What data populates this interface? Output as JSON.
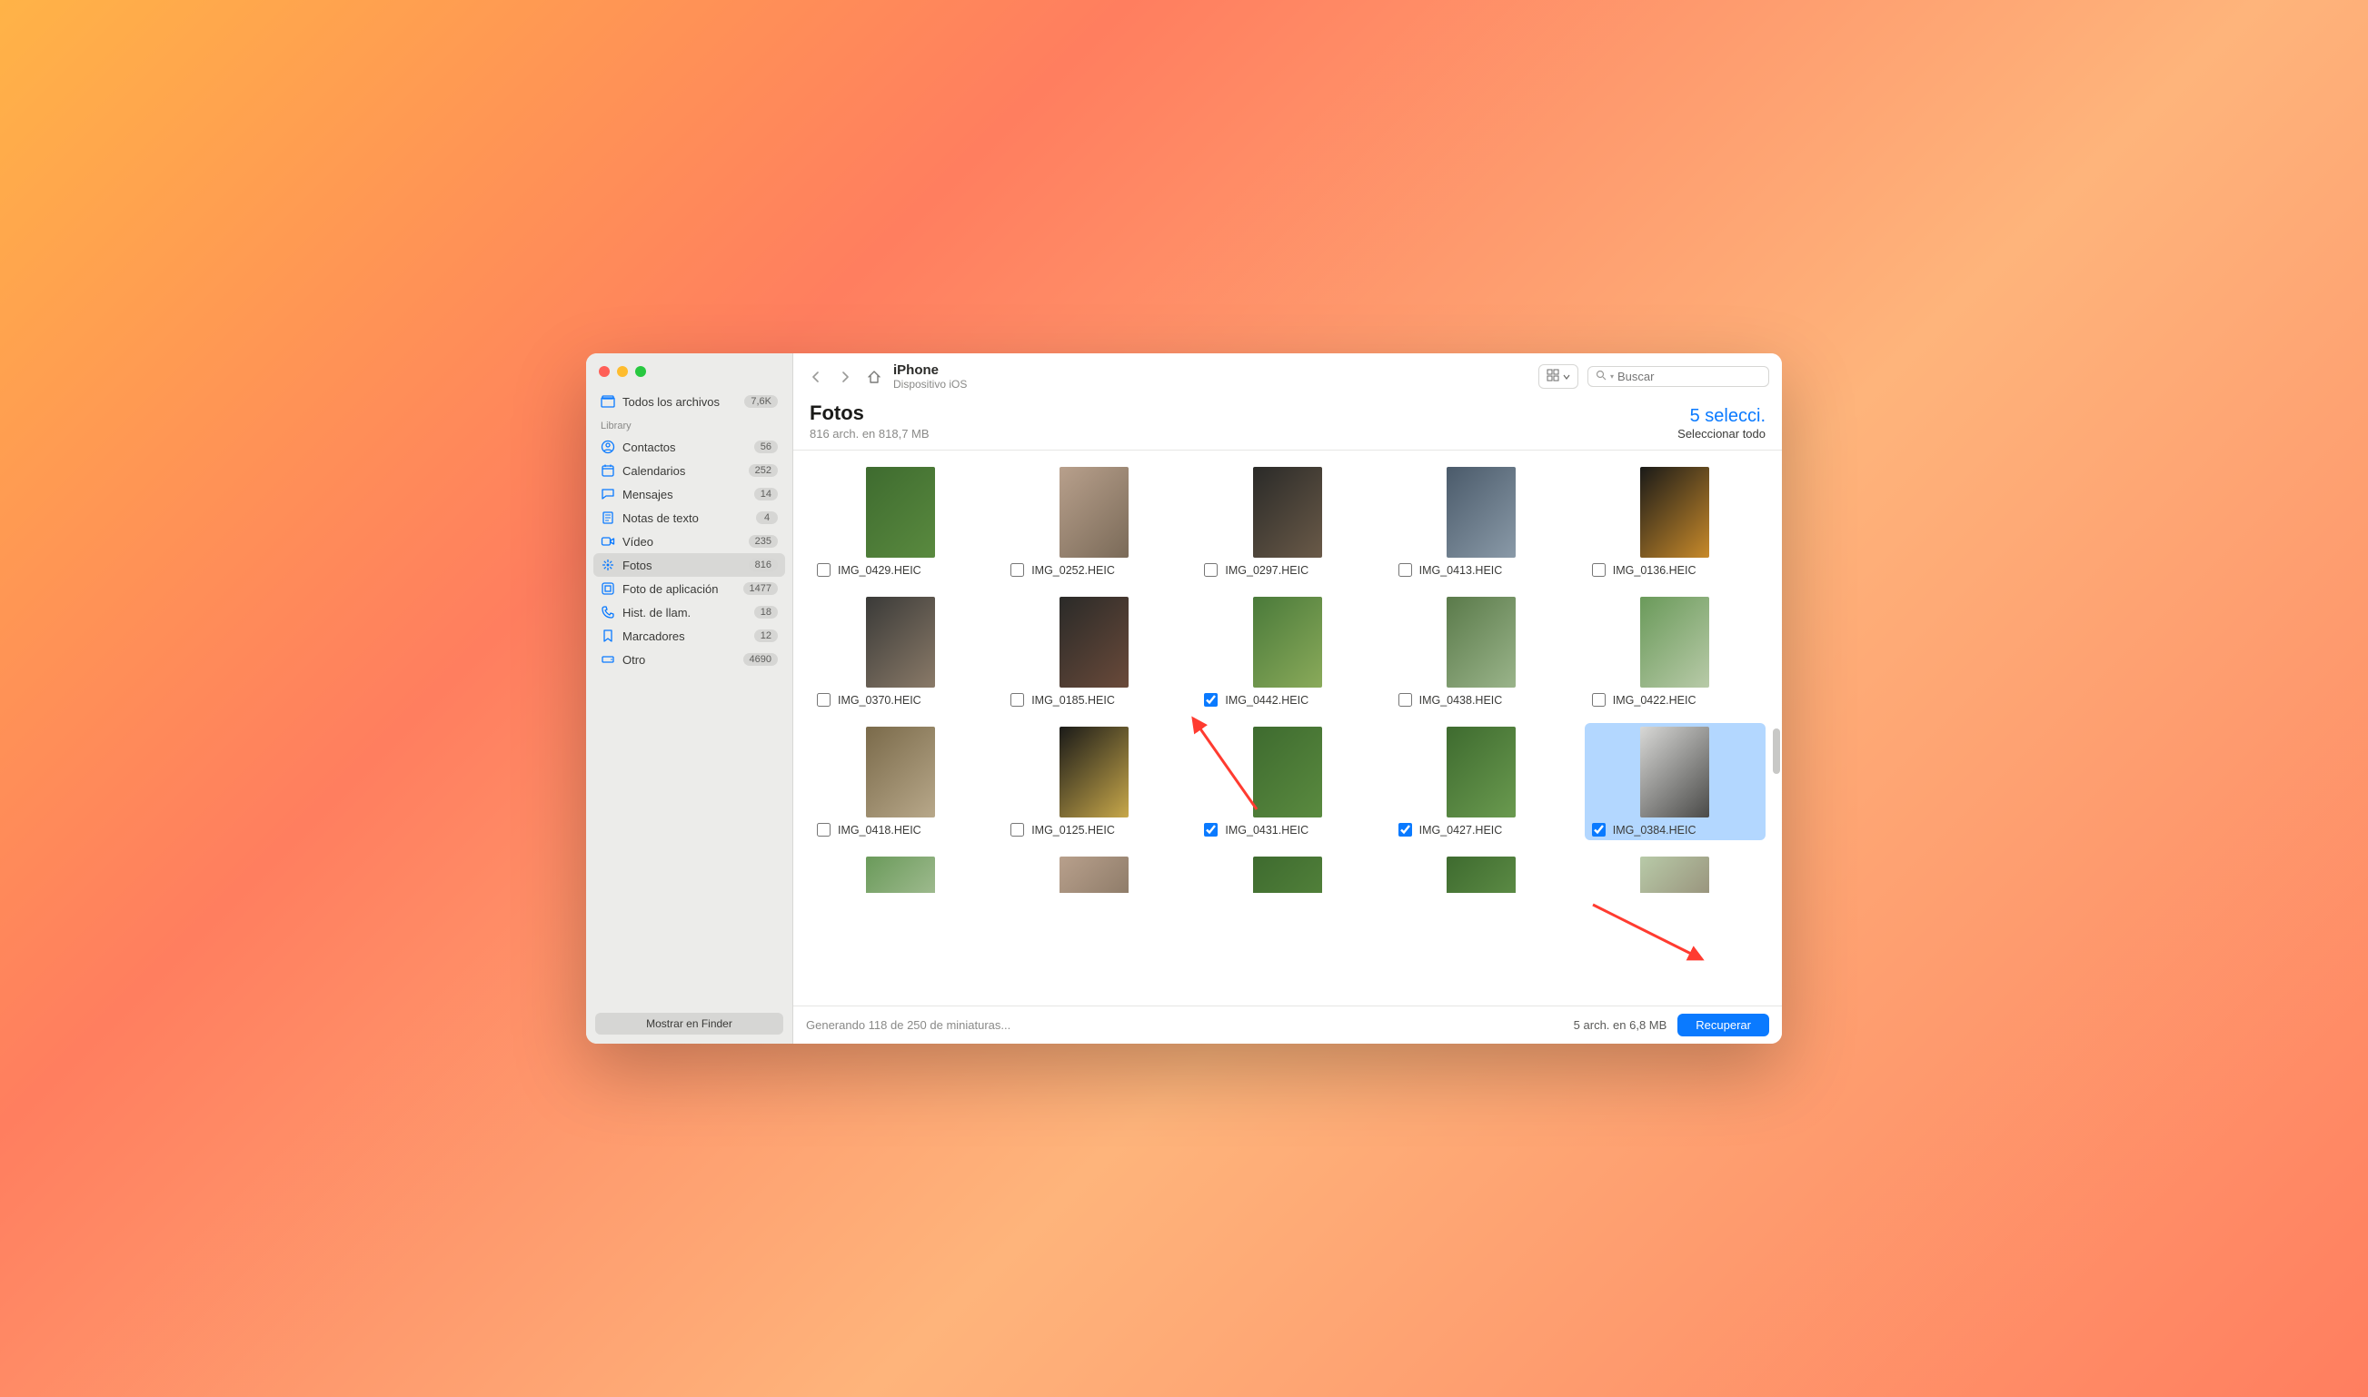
{
  "sidebar": {
    "all_files": {
      "label": "Todos los archivos",
      "count": "7,6K"
    },
    "section_label": "Library",
    "items": [
      {
        "key": "contactos",
        "label": "Contactos",
        "count": "56",
        "icon": "user-circle"
      },
      {
        "key": "calendarios",
        "label": "Calendarios",
        "count": "252",
        "icon": "calendar"
      },
      {
        "key": "mensajes",
        "label": "Mensajes",
        "count": "14",
        "icon": "chat"
      },
      {
        "key": "notas",
        "label": "Notas de texto",
        "count": "4",
        "icon": "note"
      },
      {
        "key": "video",
        "label": "Vídeo",
        "count": "235",
        "icon": "video"
      },
      {
        "key": "fotos",
        "label": "Fotos",
        "count": "816",
        "icon": "flower",
        "active": true
      },
      {
        "key": "fotoapp",
        "label": "Foto de aplicación",
        "count": "1477",
        "icon": "app"
      },
      {
        "key": "hist",
        "label": "Hist. de llam.",
        "count": "18",
        "icon": "phone"
      },
      {
        "key": "marcadores",
        "label": "Marcadores",
        "count": "12",
        "icon": "bookmark"
      },
      {
        "key": "otro",
        "label": "Otro",
        "count": "4690",
        "icon": "drive"
      }
    ],
    "footer_button": "Mostrar en Finder"
  },
  "toolbar": {
    "title": "iPhone",
    "subtitle": "Dispositivo iOS",
    "search_placeholder": "Buscar"
  },
  "content": {
    "heading": "Fotos",
    "summary": "816 arch. en 818,7 MB",
    "selected_label": "5 selecci.",
    "select_all_label": "Seleccionar todo"
  },
  "photos": [
    {
      "name": "IMG_0429.HEIC",
      "checked": false,
      "selected": false,
      "colors": [
        "#3e6b2f",
        "#5a8a3f"
      ]
    },
    {
      "name": "IMG_0252.HEIC",
      "checked": false,
      "selected": false,
      "colors": [
        "#b8a08c",
        "#7a6a58"
      ]
    },
    {
      "name": "IMG_0297.HEIC",
      "checked": false,
      "selected": false,
      "colors": [
        "#2a2a28",
        "#6a5a48"
      ]
    },
    {
      "name": "IMG_0413.HEIC",
      "checked": false,
      "selected": false,
      "colors": [
        "#4a5a6a",
        "#8a9aa8"
      ]
    },
    {
      "name": "IMG_0136.HEIC",
      "checked": false,
      "selected": false,
      "colors": [
        "#1a1a18",
        "#c88a2a"
      ]
    },
    {
      "name": "IMG_0370.HEIC",
      "checked": false,
      "selected": false,
      "colors": [
        "#3a3a38",
        "#8a7a68"
      ]
    },
    {
      "name": "IMG_0185.HEIC",
      "checked": false,
      "selected": false,
      "colors": [
        "#2a2a28",
        "#6a4a3a"
      ]
    },
    {
      "name": "IMG_0442.HEIC",
      "checked": true,
      "selected": false,
      "colors": [
        "#4a7a3a",
        "#8aaa5a"
      ]
    },
    {
      "name": "IMG_0438.HEIC",
      "checked": false,
      "selected": false,
      "colors": [
        "#5a7a4a",
        "#9ab48a"
      ]
    },
    {
      "name": "IMG_0422.HEIC",
      "checked": false,
      "selected": false,
      "colors": [
        "#6a9a5a",
        "#b8caa8"
      ]
    },
    {
      "name": "IMG_0418.HEIC",
      "checked": false,
      "selected": false,
      "colors": [
        "#7a6a4a",
        "#b8a88a"
      ]
    },
    {
      "name": "IMG_0125.HEIC",
      "checked": false,
      "selected": false,
      "colors": [
        "#1a1a18",
        "#c8a84a"
      ]
    },
    {
      "name": "IMG_0431.HEIC",
      "checked": true,
      "selected": false,
      "colors": [
        "#3e6b2f",
        "#5a8a3f"
      ]
    },
    {
      "name": "IMG_0427.HEIC",
      "checked": true,
      "selected": false,
      "colors": [
        "#3e6b2f",
        "#6a9a4f"
      ]
    },
    {
      "name": "IMG_0384.HEIC",
      "checked": true,
      "selected": true,
      "colors": [
        "#d8d8d6",
        "#4a4a48"
      ]
    }
  ],
  "partial_photos": [
    {
      "colors": [
        "#6a9a5a",
        "#b8caa8"
      ]
    },
    {
      "colors": [
        "#b8a08c",
        "#7a6a58"
      ]
    },
    {
      "colors": [
        "#3e6b2f",
        "#5a8a3f"
      ]
    },
    {
      "colors": [
        "#3e6b2f",
        "#6a9a4f"
      ]
    },
    {
      "colors": [
        "#b8caa8",
        "#8a7a68"
      ]
    }
  ],
  "footer": {
    "status": "Generando 118 de 250 de miniaturas...",
    "summary": "5 arch. en 6,8 MB",
    "recover_label": "Recuperar"
  },
  "icons": {
    "archive": "◫",
    "user-circle": "◉",
    "calendar": "▦",
    "chat": "✉",
    "note": "▤",
    "video": "■",
    "flower": "✱",
    "app": "▣",
    "phone": "✆",
    "bookmark": "▮",
    "drive": "▭"
  }
}
